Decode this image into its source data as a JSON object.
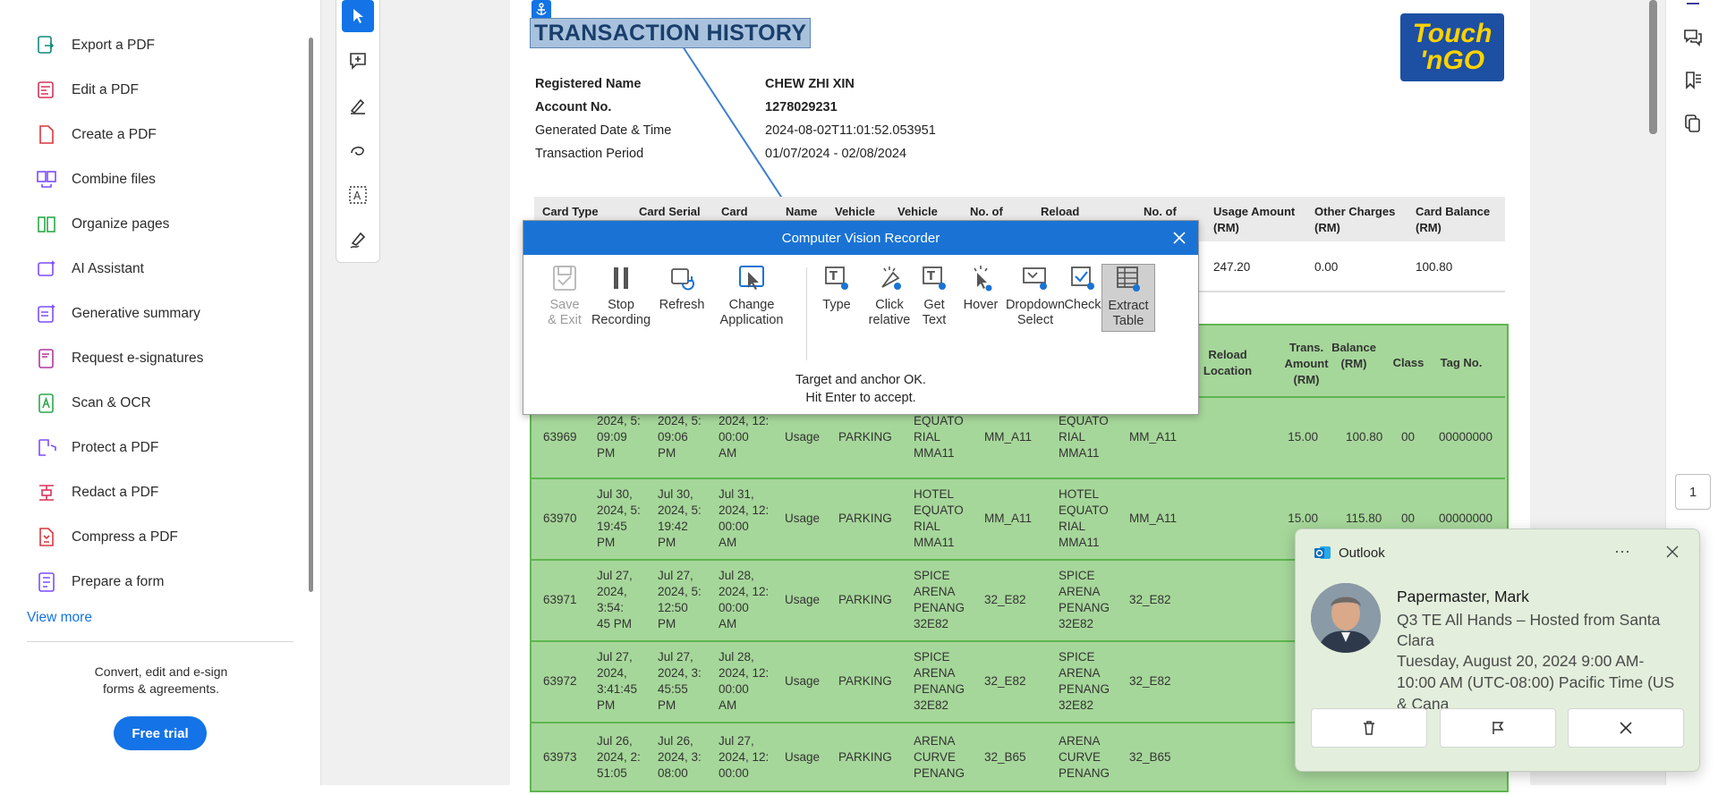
{
  "sidebar": {
    "items": [
      {
        "label": "Export a PDF",
        "icon": "export-pdf-icon",
        "color": "#0e8a7d"
      },
      {
        "label": "Edit a PDF",
        "icon": "edit-pdf-icon",
        "color": "#d6345c"
      },
      {
        "label": "Create a PDF",
        "icon": "create-pdf-icon",
        "color": "#d7373f"
      },
      {
        "label": "Combine files",
        "icon": "combine-files-icon",
        "color": "#7c4dff"
      },
      {
        "label": "Organize pages",
        "icon": "organize-pages-icon",
        "color": "#2ba84a"
      },
      {
        "label": "AI Assistant",
        "icon": "ai-assistant-icon",
        "color": "#7c4dff"
      },
      {
        "label": "Generative summary",
        "icon": "generative-summary-icon",
        "color": "#7c4dff"
      },
      {
        "label": "Request e-signatures",
        "icon": "e-signature-icon",
        "color": "#b0379c"
      },
      {
        "label": "Scan & OCR",
        "icon": "scan-ocr-icon",
        "color": "#2ba84a"
      },
      {
        "label": "Protect a PDF",
        "icon": "protect-pdf-icon",
        "color": "#7c4dff"
      },
      {
        "label": "Redact a PDF",
        "icon": "redact-pdf-icon",
        "color": "#d6345c"
      },
      {
        "label": "Compress a PDF",
        "icon": "compress-pdf-icon",
        "color": "#d7373f"
      },
      {
        "label": "Prepare a form",
        "icon": "prepare-form-icon",
        "color": "#7c4dff"
      }
    ],
    "view_more": "View more",
    "promo": "Convert, edit and e-sign forms & agreements.",
    "free_trial": "Free trial"
  },
  "document": {
    "title": "TRANSACTION HISTORY",
    "logo_line1": "Touch",
    "logo_line2": "'nGO",
    "info": [
      {
        "label": "Registered Name",
        "value": "CHEW ZHI XIN",
        "bold": true
      },
      {
        "label": "Account No.",
        "value": "1278029231",
        "bold": true
      },
      {
        "label": "Generated Date & Time",
        "value": "2024-08-02T11:01:52.053951",
        "bold": false
      },
      {
        "label": "Transaction Period",
        "value": "01/07/2024 - 02/08/2024",
        "bold": false
      }
    ],
    "summary_headers": [
      "Card Type",
      "Card Serial",
      "Card",
      "Name",
      "Vehicle",
      "Vehicle",
      "No. of",
      "Reload",
      "No. of",
      "Usage Amount (RM)",
      "Other Charges (RM)",
      "Card Balance (RM)"
    ],
    "summary_values": [
      "247.20",
      "0.00",
      "100.80"
    ],
    "table_headers": [
      "Reload Location",
      "Trans. Amount (RM)",
      "Balance (RM)",
      "Class",
      "Tag No."
    ],
    "rows": [
      {
        "no": "63969",
        "d1": "2024, 5:\n09:09\nPM",
        "d2": "2024, 5:\n09:06\nPM",
        "d3": "2024, 12:\n00:00\nAM",
        "type": "Usage",
        "cat": "PARKING",
        "loc": "EQUATO\nRIAL\nMMA11",
        "code": "MM_A11",
        "loc2": "EQUATO\nRIAL\nMMA11",
        "code2": "MM_A11",
        "amt": "15.00",
        "bal": "100.80",
        "cls": "00",
        "tag": "00000000"
      },
      {
        "no": "63970",
        "d1": "Jul 30,\n2024, 5:\n19:45\nPM",
        "d2": "Jul 30,\n2024, 5:\n19:42\nPM",
        "d3": "Jul 31,\n2024, 12:\n00:00\nAM",
        "type": "Usage",
        "cat": "PARKING",
        "loc": "HOTEL\nEQUATO\nRIAL\nMMA11",
        "code": "MM_A11",
        "loc2": "HOTEL\nEQUATO\nRIAL\nMMA11",
        "code2": "MM_A11",
        "amt": "15.00",
        "bal": "115.80",
        "cls": "00",
        "tag": "00000000"
      },
      {
        "no": "63971",
        "d1": "Jul 27,\n2024,\n3:54:\n45 PM",
        "d2": "Jul 27,\n2024, 5:\n12:50\nPM",
        "d3": "Jul 28,\n2024, 12:\n00:00\nAM",
        "type": "Usage",
        "cat": "PARKING",
        "loc": "SPICE\nARENA\nPENANG\n32E82",
        "code": "32_E82",
        "loc2": "SPICE\nARENA\nPENANG\n32E82",
        "code2": "32_E82",
        "amt": "",
        "bal": "",
        "cls": "",
        "tag": ""
      },
      {
        "no": "63972",
        "d1": "Jul 27,\n2024,\n3:41:45\nPM",
        "d2": "Jul 27,\n2024, 3:\n45:55\nPM",
        "d3": "Jul 28,\n2024, 12:\n00:00\nAM",
        "type": "Usage",
        "cat": "PARKING",
        "loc": "SPICE\nARENA\nPENANG\n32E82",
        "code": "32_E82",
        "loc2": "SPICE\nARENA\nPENANG\n32E82",
        "code2": "32_E82",
        "amt": "",
        "bal": "",
        "cls": "",
        "tag": ""
      },
      {
        "no": "63973",
        "d1": "Jul 26,\n2024, 2:\n51:05",
        "d2": "Jul 26,\n2024, 3:\n08:00",
        "d3": "Jul 27,\n2024, 12:\n00:00",
        "type": "Usage",
        "cat": "PARKING",
        "loc": "ARENA\nCURVE\nPENANG",
        "code": "32_B65",
        "loc2": "ARENA\nCURVE\nPENANG",
        "code2": "32_B65",
        "amt": "",
        "bal": "",
        "cls": "",
        "tag": ""
      }
    ]
  },
  "recorder": {
    "title": "Computer Vision Recorder",
    "buttons": [
      {
        "label": "Save\n& Exit",
        "icon": "save-icon",
        "disabled": true
      },
      {
        "label": "Stop\nRecording",
        "icon": "stop-icon",
        "disabled": false
      },
      {
        "label": "Refresh",
        "icon": "refresh-icon",
        "disabled": false
      },
      {
        "label": "Change\nApplication",
        "icon": "change-application-icon",
        "disabled": false
      },
      {
        "label": "Type",
        "icon": "type-icon",
        "disabled": false
      },
      {
        "label": "Click\nrelative",
        "icon": "click-relative-icon",
        "disabled": false
      },
      {
        "label": "Get\nText",
        "icon": "get-text-icon",
        "disabled": false
      },
      {
        "label": "Hover",
        "icon": "hover-icon",
        "disabled": false
      },
      {
        "label": "Dropdown\nSelect",
        "icon": "dropdown-select-icon",
        "disabled": false
      },
      {
        "label": "Check",
        "icon": "check-icon",
        "disabled": false
      },
      {
        "label": "Extract\nTable",
        "icon": "extract-table-icon",
        "disabled": false,
        "selected": true
      }
    ],
    "status_line1": "Target and anchor OK.",
    "status_line2": "Hit Enter to accept."
  },
  "toast": {
    "app": "Outlook",
    "more": "···",
    "sender": "Papermaster, Mark",
    "subject": "Q3 TE All Hands – Hosted from Santa Clara",
    "time": "Tuesday, August 20, 2024 9:00 AM-10:00 AM (UTC-08:00) Pacific Time (US & Cana"
  },
  "page_number": "1",
  "colors": {
    "accent": "#1473e6",
    "table_green": "#a6d79a",
    "selection": "#a8c2dd"
  }
}
